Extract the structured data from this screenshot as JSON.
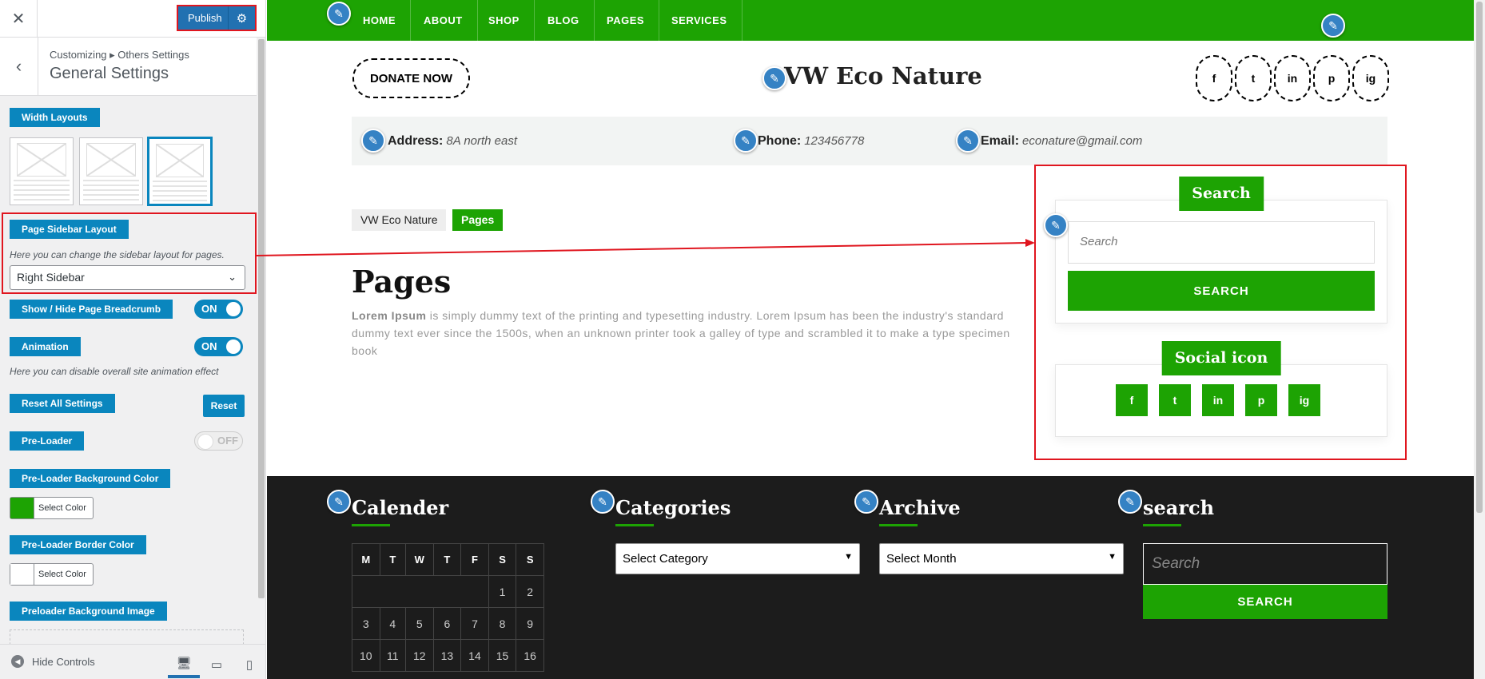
{
  "panel": {
    "close_icon": "close-icon",
    "publish_label": "Publish",
    "breadcrumb": "Customizing ▸ Others Settings",
    "title": "General Settings",
    "width_layouts_label": "Width Layouts",
    "sidebar_layout_label": "Page Sidebar Layout",
    "sidebar_layout_desc": "Here you can change the sidebar layout for pages.",
    "sidebar_layout_value": "Right Sidebar",
    "breadcrumb_toggle_label": "Show / Hide Page Breadcrumb",
    "breadcrumb_toggle_state": "ON",
    "animation_label": "Animation",
    "animation_state": "ON",
    "animation_desc": "Here you can disable overall site animation effect",
    "reset_label": "Reset All Settings",
    "reset_button": "Reset",
    "preloader_label": "Pre-Loader",
    "preloader_state": "OFF",
    "preloader_bg_label": "Pre-Loader Background Color",
    "preloader_bg_color": "#1da303",
    "select_color": "Select Color",
    "preloader_border_label": "Pre-Loader Border Color",
    "preloader_border_color": "#ffffff",
    "preloader_img_label": "Preloader Background Image",
    "hide_controls": "Hide Controls"
  },
  "site": {
    "accent": "#1da303",
    "nav": [
      "HOME",
      "ABOUT",
      "SHOP",
      "BLOG",
      "PAGES",
      "SERVICES"
    ],
    "donate": "DONATE NOW",
    "title": "VW Eco Nature",
    "social": [
      "f",
      "t",
      "in",
      "p",
      "ig"
    ],
    "address_label": "Address:",
    "address_value": "8A north east",
    "phone_label": "Phone:",
    "phone_value": "123456778",
    "email_label": "Email:",
    "email_value": "econature@gmail.com",
    "breadcrumb_home": "VW Eco Nature",
    "breadcrumb_current": "Pages",
    "page_title": "Pages",
    "body_bold": "Lorem Ipsum",
    "body_text": " is simply dummy text of the printing and typesetting industry. Lorem Ipsum has been the industry's standard dummy text ever since the 1500s, when an unknown printer took a galley of type and scrambled it to make a type specimen book",
    "search_widget_title": "Search",
    "search_placeholder": "Search",
    "search_button": "SEARCH",
    "social_widget_title": "Social icon"
  },
  "footer": {
    "calendar_title": "Calender",
    "calendar_days": [
      "M",
      "T",
      "W",
      "T",
      "F",
      "S",
      "S"
    ],
    "calendar_rows": [
      [
        "",
        "",
        "",
        "",
        "",
        "1",
        "2"
      ],
      [
        "3",
        "4",
        "5",
        "6",
        "7",
        "8",
        "9"
      ],
      [
        "10",
        "11",
        "12",
        "13",
        "14",
        "15",
        "16"
      ]
    ],
    "categories_title": "Categories",
    "categories_select": "Select Category",
    "archive_title": "Archive",
    "archive_select": "Select Month",
    "search_title": "search",
    "search_placeholder": "Search",
    "search_button": "SEARCH"
  }
}
